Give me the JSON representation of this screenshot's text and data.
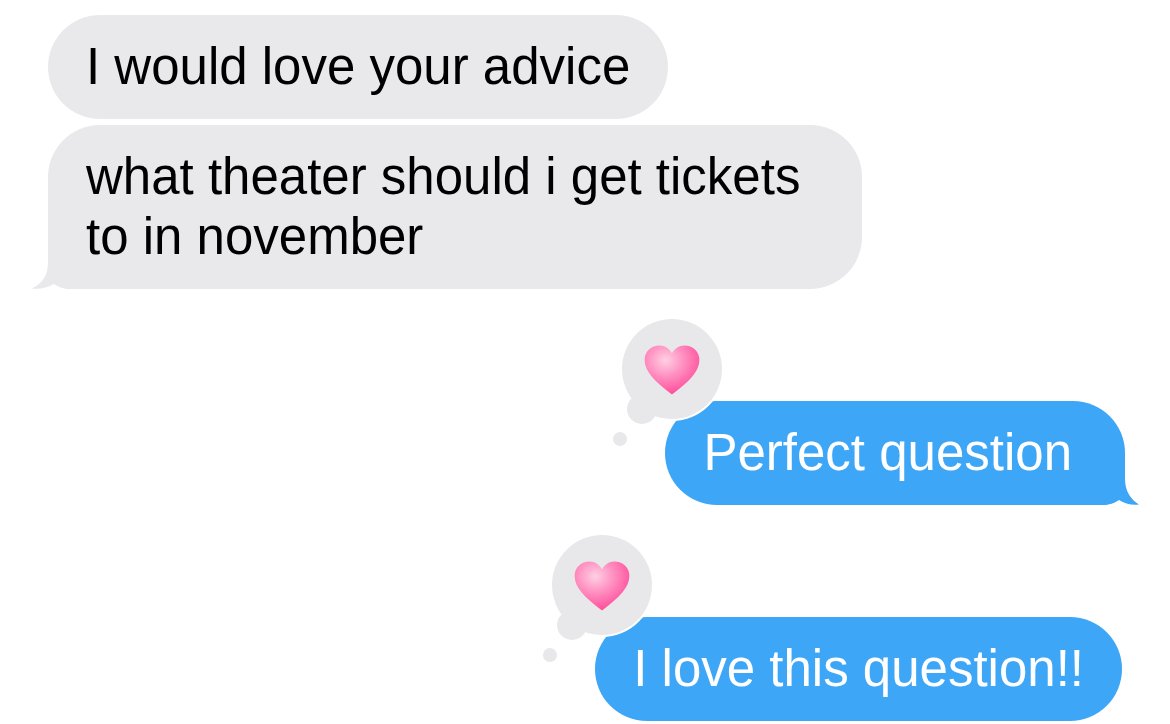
{
  "messages": [
    {
      "kind": "received",
      "text": "I would love your advice",
      "tail": false,
      "hearted": false
    },
    {
      "kind": "received",
      "text": "what theater should i get tickets to in november",
      "tail": true,
      "hearted": false
    },
    {
      "kind": "sent",
      "text": "Perfect question",
      "tail": true,
      "hearted": true
    },
    {
      "kind": "sent",
      "text": "I love this question!!",
      "tail": false,
      "hearted": true
    }
  ]
}
